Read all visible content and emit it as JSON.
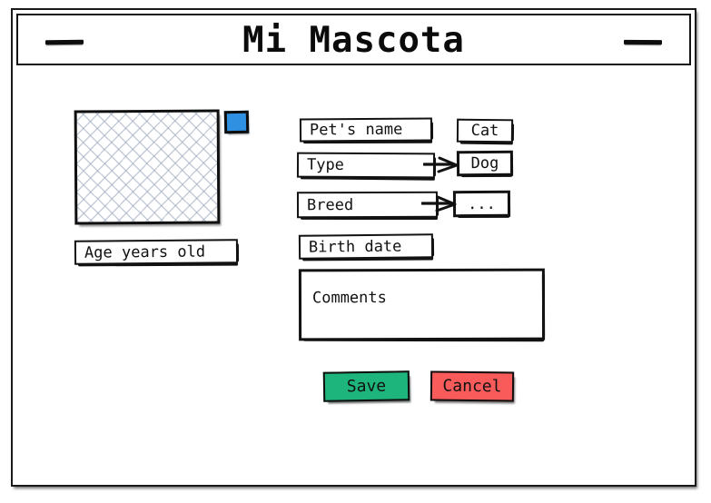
{
  "window": {
    "title": "Mi Mascota",
    "left_control": "minimize-dash",
    "right_control": "minimize-dash"
  },
  "photo": {
    "placeholder_name": "pet-photo-placeholder",
    "upload_button_color": "#2f90e2"
  },
  "fields": {
    "age": "Age years old",
    "pet_name": "Pet's name",
    "type": "Type",
    "breed": "Breed",
    "birth_date": "Birth date",
    "comments": "Comments"
  },
  "type_options": [
    {
      "label": "Cat"
    },
    {
      "label": "Dog"
    }
  ],
  "breed_options": [
    {
      "label": "..."
    }
  ],
  "buttons": {
    "save": "Save",
    "cancel": "Cancel",
    "save_color": "#1db57b",
    "cancel_color": "#f95b5b"
  }
}
